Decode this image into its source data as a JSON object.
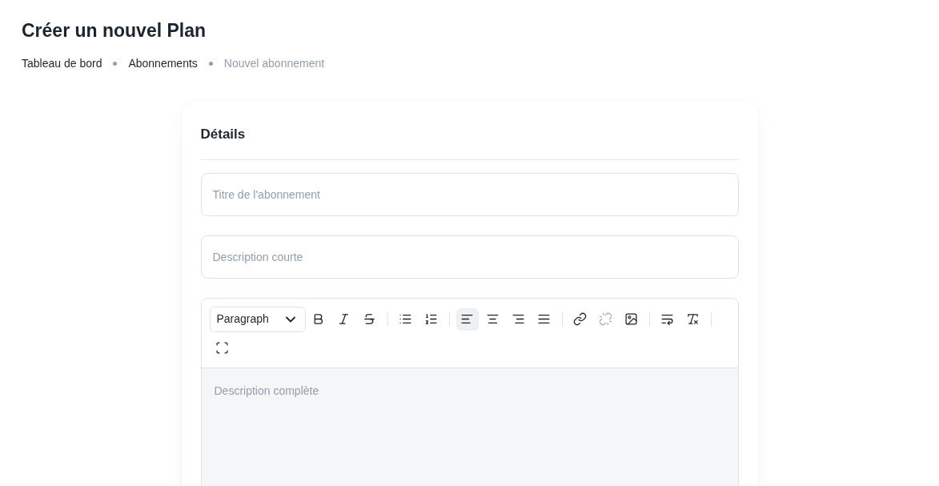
{
  "page_title": "Créer un nouvel Plan",
  "breadcrumbs": [
    {
      "label": "Tableau de bord",
      "selected": false
    },
    {
      "label": "Abonnements",
      "selected": false
    },
    {
      "label": "Nouvel abonnement",
      "selected": true
    }
  ],
  "card": {
    "title": "Détails",
    "fields": [
      {
        "placeholder": "Titre de l'abonnement"
      },
      {
        "placeholder": "Description courte"
      }
    ],
    "editor": {
      "block_format": "Paragraph",
      "placeholder": "Description complète",
      "tool_groups": [
        [
          {
            "kind": "bold",
            "selected": false,
            "disabled": false
          },
          {
            "kind": "italic",
            "selected": false,
            "disabled": false
          },
          {
            "kind": "strike",
            "selected": false,
            "disabled": false
          }
        ],
        [
          {
            "kind": "bullets",
            "selected": false,
            "disabled": false
          },
          {
            "kind": "numbers",
            "selected": false,
            "disabled": false
          }
        ],
        [
          {
            "kind": "align-left",
            "selected": true,
            "disabled": false
          },
          {
            "kind": "align-center",
            "selected": false,
            "disabled": false
          },
          {
            "kind": "align-right",
            "selected": false,
            "disabled": false
          },
          {
            "kind": "justify",
            "selected": false,
            "disabled": false
          }
        ],
        [
          {
            "kind": "link",
            "selected": false,
            "disabled": false
          },
          {
            "kind": "unlink",
            "selected": false,
            "disabled": true
          },
          {
            "kind": "image",
            "selected": false,
            "disabled": false
          }
        ],
        [
          {
            "kind": "wrap",
            "selected": false,
            "disabled": false
          },
          {
            "kind": "clear-format",
            "selected": false,
            "disabled": false
          }
        ],
        [
          {
            "kind": "fullscreen",
            "selected": false,
            "disabled": false
          }
        ]
      ]
    }
  }
}
